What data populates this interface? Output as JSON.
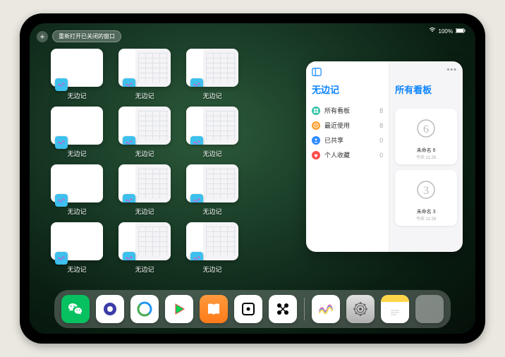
{
  "status": {
    "wifi": "wifi-icon",
    "battery": "100%"
  },
  "top": {
    "add": "+",
    "recent_label": "重新打开已关闭的窗口"
  },
  "app_name": "无边记",
  "grid": [
    {
      "type": "blank",
      "label": "无边记"
    },
    {
      "type": "content",
      "label": "无边记"
    },
    {
      "type": "content",
      "label": "无边记"
    },
    null,
    {
      "type": "blank",
      "label": "无边记"
    },
    {
      "type": "content",
      "label": "无边记"
    },
    {
      "type": "content",
      "label": "无边记"
    },
    null,
    {
      "type": "blank",
      "label": "无边记"
    },
    {
      "type": "content",
      "label": "无边记"
    },
    {
      "type": "content",
      "label": "无边记"
    },
    null,
    {
      "type": "blank",
      "label": "无边记"
    },
    {
      "type": "content",
      "label": "无边记"
    },
    {
      "type": "content",
      "label": "无边记"
    }
  ],
  "popover": {
    "left_title": "无边记",
    "right_title": "所有看板",
    "items": [
      {
        "icon": "grid",
        "color": "#34c4a8",
        "label": "所有看板",
        "count": "8"
      },
      {
        "icon": "clock",
        "color": "#ff9f2e",
        "label": "最近使用",
        "count": "8"
      },
      {
        "icon": "people",
        "color": "#2e8bff",
        "label": "已共享",
        "count": "0"
      },
      {
        "icon": "heart",
        "color": "#ff4d4d",
        "label": "个人收藏",
        "count": "0"
      }
    ],
    "boards": [
      {
        "sketch": "6",
        "name": "未命名 6",
        "date": "今天 11:28"
      },
      {
        "sketch": "3",
        "name": "未命名 3",
        "date": "今天 11:28"
      }
    ]
  },
  "dock": [
    {
      "id": "wechat",
      "name": "wechat-icon"
    },
    {
      "id": "quark",
      "name": "quark-icon"
    },
    {
      "id": "browser",
      "name": "qq-browser-icon"
    },
    {
      "id": "aiqiyi",
      "name": "iqiyi-icon"
    },
    {
      "id": "books",
      "name": "books-icon"
    },
    {
      "id": "dice",
      "name": "dice-icon"
    },
    {
      "id": "connect",
      "name": "connect-icon"
    },
    {
      "id": "sep"
    },
    {
      "id": "freeform",
      "name": "freeform-icon"
    },
    {
      "id": "settings",
      "name": "settings-icon"
    },
    {
      "id": "notes",
      "name": "notes-icon"
    },
    {
      "id": "appfolder",
      "name": "app-library-icon"
    }
  ]
}
